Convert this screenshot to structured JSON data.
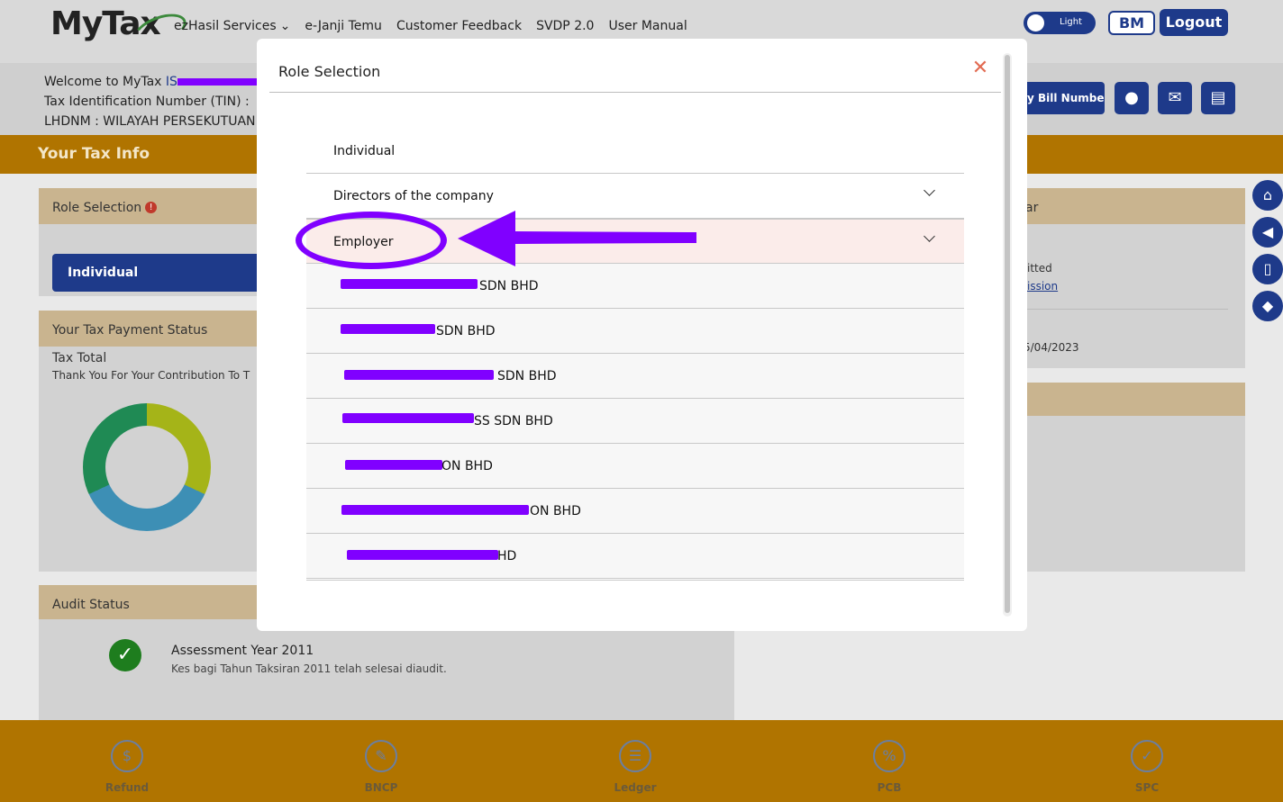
{
  "header": {
    "logo_my": "My",
    "logo_tax": "Tax",
    "nav": [
      "ezHasil Services",
      "e-Janji Temu",
      "Customer Feedback",
      "SVDP 2.0",
      "User Manual"
    ],
    "theme_toggle_label": "Light",
    "lang_button": "BM",
    "logout_button": "Logout"
  },
  "welcome": {
    "line1": "Welcome to MyTax",
    "line1_name_partial": "IS",
    "line2": "Tax Identification Number (TIN) :",
    "line3": "LHDNM : WILAYAH PERSEKUTUAN",
    "bill_button": "y Bill Number"
  },
  "tax_info": {
    "title": "Your Tax Info"
  },
  "role_card": {
    "title": "Role Selection",
    "info_badge": "!",
    "selected_role": "Individual"
  },
  "payment_card": {
    "title": "Your Tax Payment Status",
    "total_label": "Tax Total",
    "thanks": "Thank You For Your Contribution To T"
  },
  "right_card": {
    "head_fragment": "ar",
    "line1": "itted",
    "link": "ission",
    "date_fragment": "5/04/2023"
  },
  "audit_card": {
    "title": "Audit Status",
    "year": "Assessment Year 2011",
    "desc": "Kes bagi Tahun Taksiran 2011 telah selesai diaudit."
  },
  "footer": {
    "items": [
      "Refund",
      "BNCP",
      "Ledger",
      "PCB",
      "SPC"
    ]
  },
  "modal": {
    "title": "Role Selection",
    "close_symbol": "✕",
    "roles": [
      "Individual",
      "Directors of the company",
      "Employer"
    ],
    "employers": [
      "SDN BHD",
      "SDN BHD",
      "SDN BHD",
      "SS SDN BHD",
      "ON BHD",
      "ON BHD",
      "HD"
    ]
  },
  "colors": {
    "primary": "#1e3a8a",
    "accent_bar": "#b07400",
    "annotation": "#8000ff",
    "active_row": "#fbecea"
  }
}
